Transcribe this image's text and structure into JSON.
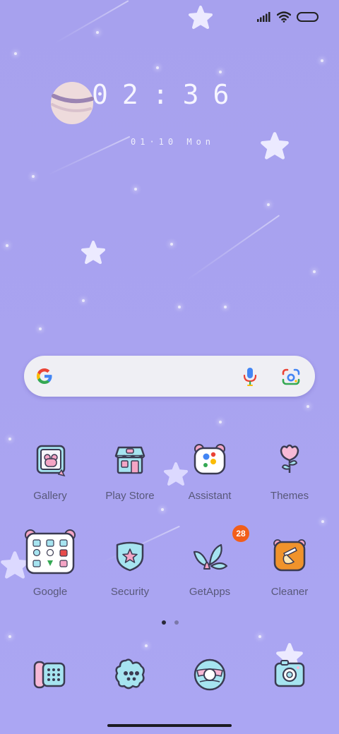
{
  "status_bar": {
    "signal_icon": "cellular-signal-icon",
    "wifi_icon": "wifi-icon",
    "battery_icon": "battery-icon"
  },
  "clock": {
    "time": "02:36",
    "date": "01·10 Mon"
  },
  "search_bar": {
    "logo": "google-g-logo",
    "mic_icon": "microphone-icon",
    "lens_icon": "google-lens-icon"
  },
  "apps_row1": [
    {
      "label": "Gallery",
      "icon": "gallery-icon"
    },
    {
      "label": "Play Store",
      "icon": "play-store-icon"
    },
    {
      "label": "Assistant",
      "icon": "assistant-icon"
    },
    {
      "label": "Themes",
      "icon": "themes-icon"
    }
  ],
  "apps_row2": [
    {
      "label": "Google",
      "icon": "google-folder-icon"
    },
    {
      "label": "Security",
      "icon": "security-icon"
    },
    {
      "label": "GetApps",
      "icon": "getapps-icon",
      "badge": "28"
    },
    {
      "label": "Cleaner",
      "icon": "cleaner-icon"
    }
  ],
  "page_indicator": {
    "pages": 2,
    "current": 1
  },
  "dock": [
    {
      "icon": "phone-icon"
    },
    {
      "icon": "messages-icon"
    },
    {
      "icon": "browser-icon"
    },
    {
      "icon": "camera-icon"
    }
  ],
  "colors": {
    "background": "#a9a3f0",
    "label": "#58587a",
    "badge": "#f25e1a",
    "icon_outline": "#3b3b52",
    "icon_blue": "#a6e4f0",
    "icon_pink": "#f7b9d6"
  }
}
